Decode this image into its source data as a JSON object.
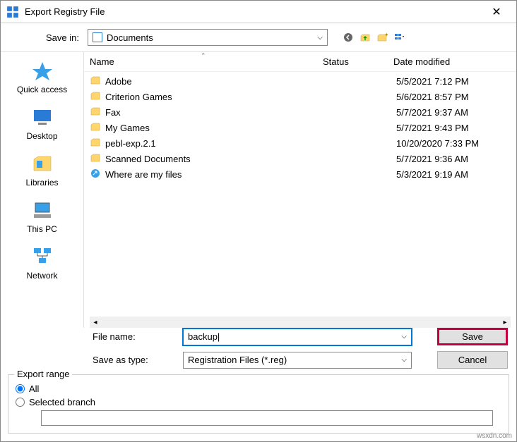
{
  "window": {
    "title": "Export Registry File",
    "close_glyph": "✕"
  },
  "toolbar": {
    "save_in_label": "Save in:",
    "save_in_value": "Documents"
  },
  "sidebar": {
    "items": [
      {
        "label": "Quick access"
      },
      {
        "label": "Desktop"
      },
      {
        "label": "Libraries"
      },
      {
        "label": "This PC"
      },
      {
        "label": "Network"
      }
    ]
  },
  "columns": {
    "name": "Name",
    "status": "Status",
    "date": "Date modified"
  },
  "files": [
    {
      "name": "Adobe",
      "type": "folder",
      "date": "5/5/2021 7:12 PM"
    },
    {
      "name": "Criterion Games",
      "type": "folder",
      "date": "5/6/2021 8:57 PM"
    },
    {
      "name": "Fax",
      "type": "folder",
      "date": "5/7/2021 9:37 AM"
    },
    {
      "name": "My Games",
      "type": "folder",
      "date": "5/7/2021 9:43 PM"
    },
    {
      "name": "pebl-exp.2.1",
      "type": "folder",
      "date": "10/20/2020 7:33 PM"
    },
    {
      "name": "Scanned Documents",
      "type": "folder",
      "date": "5/7/2021 9:36 AM"
    },
    {
      "name": "Where are my files",
      "type": "link",
      "date": "5/3/2021 9:19 AM"
    }
  ],
  "form": {
    "filename_label": "File name:",
    "filename_value": "backup",
    "saveastype_label": "Save as type:",
    "saveastype_value": "Registration Files (*.reg)",
    "save_btn": "Save",
    "cancel_btn": "Cancel"
  },
  "export": {
    "legend": "Export range",
    "all_label": "All",
    "selected_label": "Selected branch",
    "branch_value": ""
  },
  "watermark": "wsxdn.com"
}
